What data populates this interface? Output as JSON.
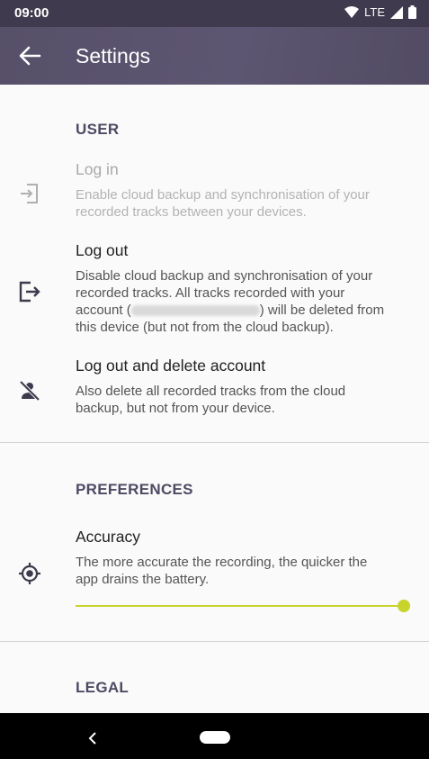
{
  "status_bar": {
    "time": "09:00",
    "network": "LTE"
  },
  "app_bar": {
    "title": "Settings"
  },
  "sections": {
    "user": {
      "header": "USER",
      "login": {
        "title": "Log in",
        "summary_line1": "Enable cloud backup and synchronisation of your",
        "summary_line2": "recorded tracks between your devices."
      },
      "logout": {
        "title": "Log out",
        "summary_line1": "Disable cloud backup and synchronisation of your",
        "summary_line2": "recorded tracks. All tracks recorded with your",
        "summary_line3_pre": "account (",
        "summary_line3_post": ") will be deleted from",
        "summary_line4": "this device (but not from the cloud backup)."
      },
      "delete_account": {
        "title": "Log out and delete account",
        "summary_line1": "Also delete all recorded tracks from the cloud",
        "summary_line2": "backup, but not from your device."
      }
    },
    "preferences": {
      "header": "PREFERENCES",
      "accuracy": {
        "title": "Accuracy",
        "summary_line1": "The more accurate the recording, the quicker the",
        "summary_line2": "app drains the battery.",
        "slider_value": 1.0
      }
    },
    "legal": {
      "header": "LEGAL"
    }
  },
  "colors": {
    "app_bar": "#5a536c",
    "status_bar": "#3f3a4d",
    "section_header": "#4e4a63",
    "accent": "#c8d42b"
  }
}
